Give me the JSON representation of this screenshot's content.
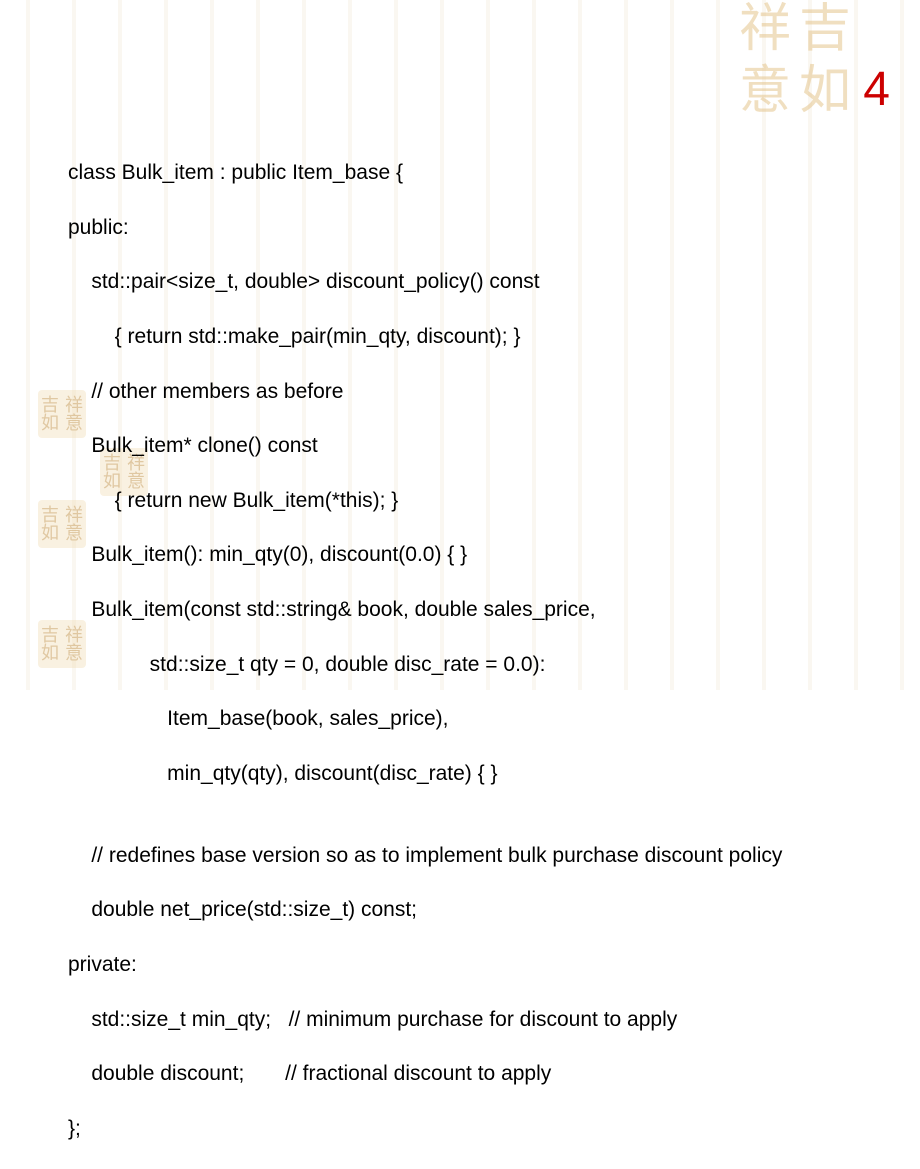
{
  "page_number": "4",
  "seal_chars": {
    "c1": "吉",
    "c2": "祥",
    "c3": "如",
    "c4": "意"
  },
  "code": {
    "l01": "class Bulk_item : public Item_base {",
    "l02": "public:",
    "l03": "    std::pair<size_t, double> discount_policy() const",
    "l04": "        { return std::make_pair(min_qty, discount); }",
    "l05": "    // other members as before",
    "l06": "    Bulk_item* clone() const ",
    "l07": "        { return new Bulk_item(*this); }",
    "l08": "    Bulk_item(): min_qty(0), discount(0.0) { }",
    "l09": "    Bulk_item(const std::string& book, double sales_price,",
    "l10": "              std::size_t qty = 0, double disc_rate = 0.0):",
    "l11": "                 Item_base(book, sales_price), ",
    "l12": "                 min_qty(qty), discount(disc_rate) { }",
    "l13": "",
    "l14": "    // redefines base version so as to implement bulk purchase discount policy",
    "l15": "    double net_price(std::size_t) const;",
    "l16": "private:",
    "l17": "    std::size_t min_qty;   // minimum purchase for discount to apply",
    "l18": "    double discount;       // fractional discount to apply",
    "l19": "};"
  }
}
